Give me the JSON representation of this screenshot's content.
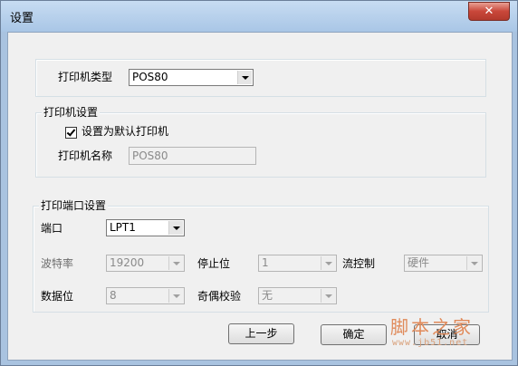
{
  "window": {
    "title": "设置",
    "close_glyph": "✕"
  },
  "printer_type": {
    "label": "打印机类型",
    "value": "POS80"
  },
  "printer_settings": {
    "group_title": "打印机设置",
    "default_label": "设置为默认打印机",
    "default_checked": true,
    "name_label": "打印机名称",
    "name_value": "POS80"
  },
  "port_settings": {
    "group_title": "打印端口设置",
    "port_label": "端口",
    "port_value": "LPT1",
    "baud_label": "波特率",
    "baud_value": "19200",
    "stop_label": "停止位",
    "stop_value": "1",
    "flow_label": "流控制",
    "flow_value": "硬件",
    "data_label": "数据位",
    "data_value": "8",
    "parity_label": "奇偶校验",
    "parity_value": "无"
  },
  "buttons": {
    "prev": "上一步",
    "ok": "确定",
    "cancel": "取消"
  },
  "watermark": {
    "text": "脚本之家",
    "url": "www.jb51.net"
  }
}
